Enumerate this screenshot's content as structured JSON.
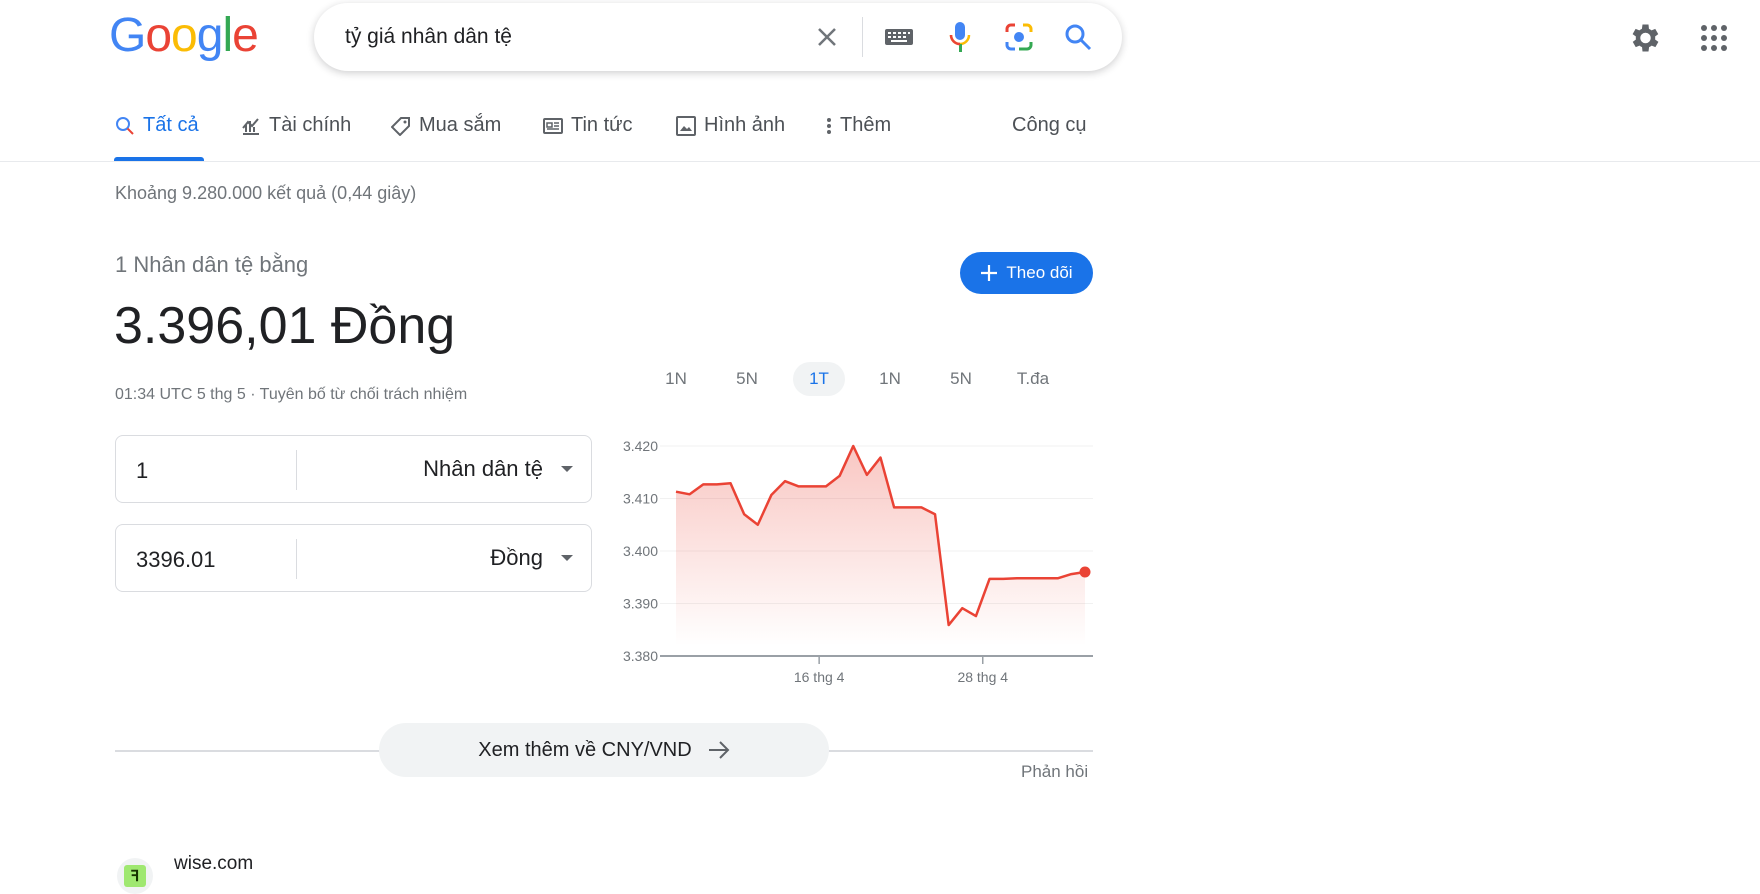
{
  "logo": "Google",
  "search": {
    "query": "tỷ giá nhân dân tệ"
  },
  "tabs": [
    {
      "label": "Tất cả",
      "icon": "search-icon",
      "selected": true
    },
    {
      "label": "Tài chính",
      "icon": "finance-icon"
    },
    {
      "label": "Mua sắm",
      "icon": "tag-icon"
    },
    {
      "label": "Tin tức",
      "icon": "news-icon"
    },
    {
      "label": "Hình ảnh",
      "icon": "image-icon"
    },
    {
      "label": "Thêm",
      "icon": "more-vert-icon"
    }
  ],
  "tools_label": "Công cụ",
  "stats": "Khoảng 9.280.000 kết quả (0,44 giây)",
  "converter": {
    "equals_label": "1 Nhân dân tệ bằng",
    "amount": "3.396,01 Đồng",
    "follow_label": "Theo dõi",
    "timestamp": "01:34 UTC 5 thg 5 · Tuyên bố từ chối trách nhiệm",
    "from_value": "1",
    "from_currency": "Nhân dân tệ",
    "to_value": "3396.01",
    "to_currency": "Đồng",
    "ranges": [
      "1N",
      "5N",
      "1T",
      "1N",
      "5N",
      "T.đa"
    ],
    "selected_range": 2
  },
  "chart_data": {
    "type": "line",
    "ylim": [
      3.38,
      3.42
    ],
    "yticks": [
      "3.420",
      "3.410",
      "3.400",
      "3.390",
      "3.380"
    ],
    "xticks": [
      {
        "label": "16 thg 4",
        "index": 10.5
      },
      {
        "label": "28 thg 4",
        "index": 22.5
      }
    ],
    "values": [
      3.4113,
      3.4108,
      3.4127,
      3.4127,
      3.4129,
      3.407,
      3.405,
      3.4107,
      3.4133,
      3.4123,
      3.4123,
      3.4123,
      3.4143,
      3.42,
      3.4145,
      3.4178,
      3.4083,
      3.4083,
      3.4083,
      3.407,
      3.3859,
      3.3891,
      3.3876,
      3.3947,
      3.3947,
      3.3948,
      3.3948,
      3.3948,
      3.3948,
      3.3956,
      3.396
    ],
    "color": "#ea4335",
    "grid": true
  },
  "more_label": "Xem thêm về CNY/VND",
  "feedback": "Phản hồi",
  "result": {
    "site": "wise.com",
    "favicon": "7"
  }
}
